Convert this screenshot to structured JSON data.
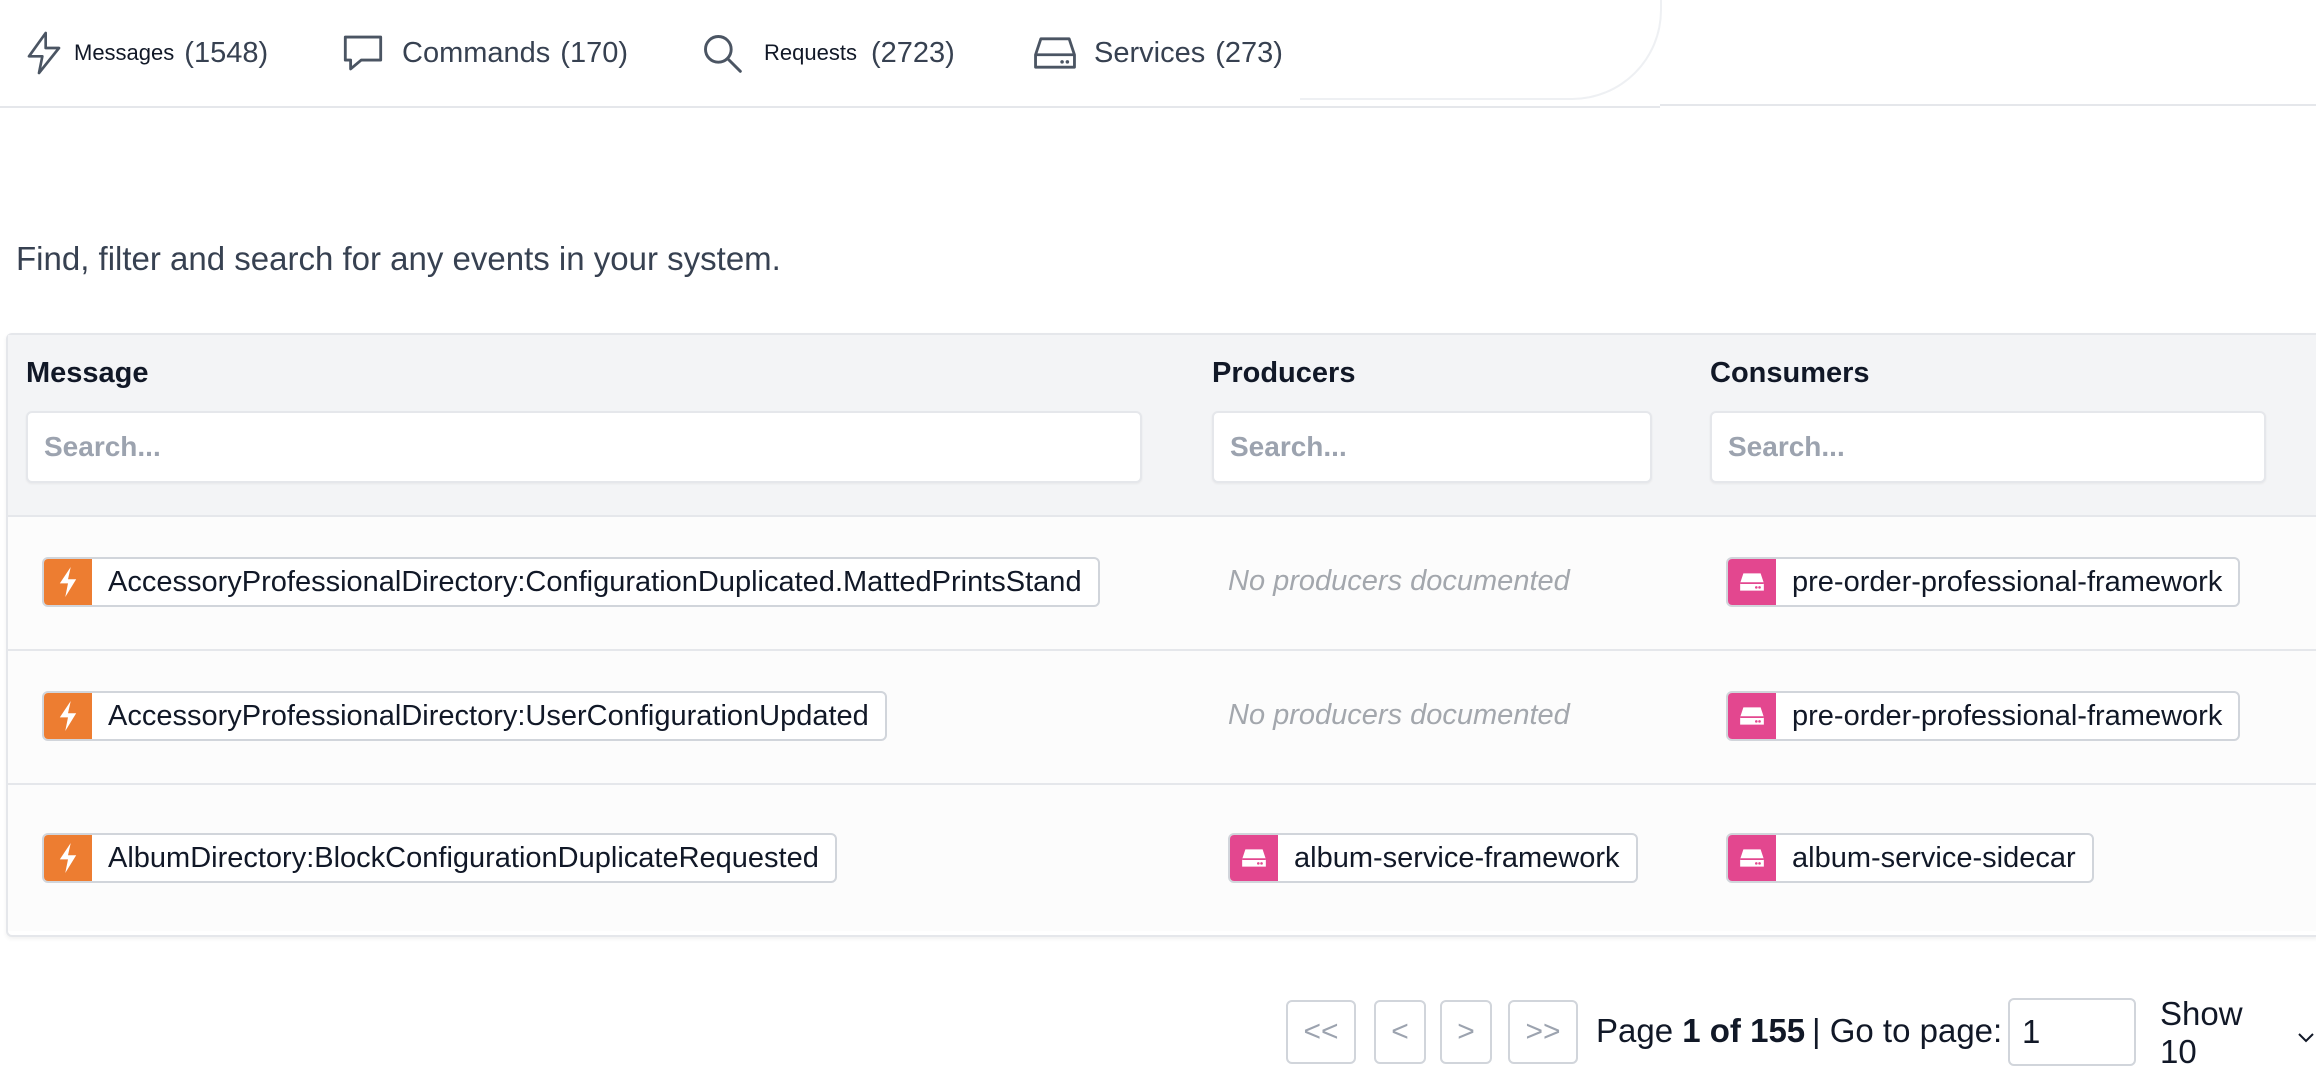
{
  "tabs": [
    {
      "label": "Messages",
      "count": "(1548)",
      "icon": "lightning-icon"
    },
    {
      "label": "Commands",
      "count": "(170)",
      "icon": "chat-bubble-icon"
    },
    {
      "label": "Requests",
      "count": "(2723)",
      "icon": "search-icon"
    },
    {
      "label": "Services",
      "count": "(273)",
      "icon": "server-icon"
    }
  ],
  "intro": "Find, filter and search for any events in your system.",
  "table": {
    "headers": {
      "message": "Message",
      "producers": "Producers",
      "consumers": "Consumers"
    },
    "search_placeholder": "Search...",
    "no_producers": "No producers documented",
    "rows": [
      {
        "message": "AccessoryProfessionalDirectory:ConfigurationDuplicated.MattedPrintsStand",
        "producer": null,
        "consumer": "pre-order-professional-framework"
      },
      {
        "message": "AccessoryProfessionalDirectory:UserConfigurationUpdated",
        "producer": null,
        "consumer": "pre-order-professional-framework"
      },
      {
        "message": "AlbumDirectory:BlockConfigurationDuplicateRequested",
        "producer": "album-service-framework",
        "consumer": "album-service-sidecar"
      }
    ]
  },
  "pagination": {
    "first": "<<",
    "prev": "<",
    "next": ">",
    "last": ">>",
    "page_prefix": "Page",
    "page_current": "1 of 155",
    "goto_label": "| Go to page:",
    "goto_value": "1",
    "show_label": "Show 10"
  },
  "colors": {
    "message_badge": "#ed7d31",
    "service_badge": "#e3478f",
    "header_bg": "#f3f4f6"
  }
}
